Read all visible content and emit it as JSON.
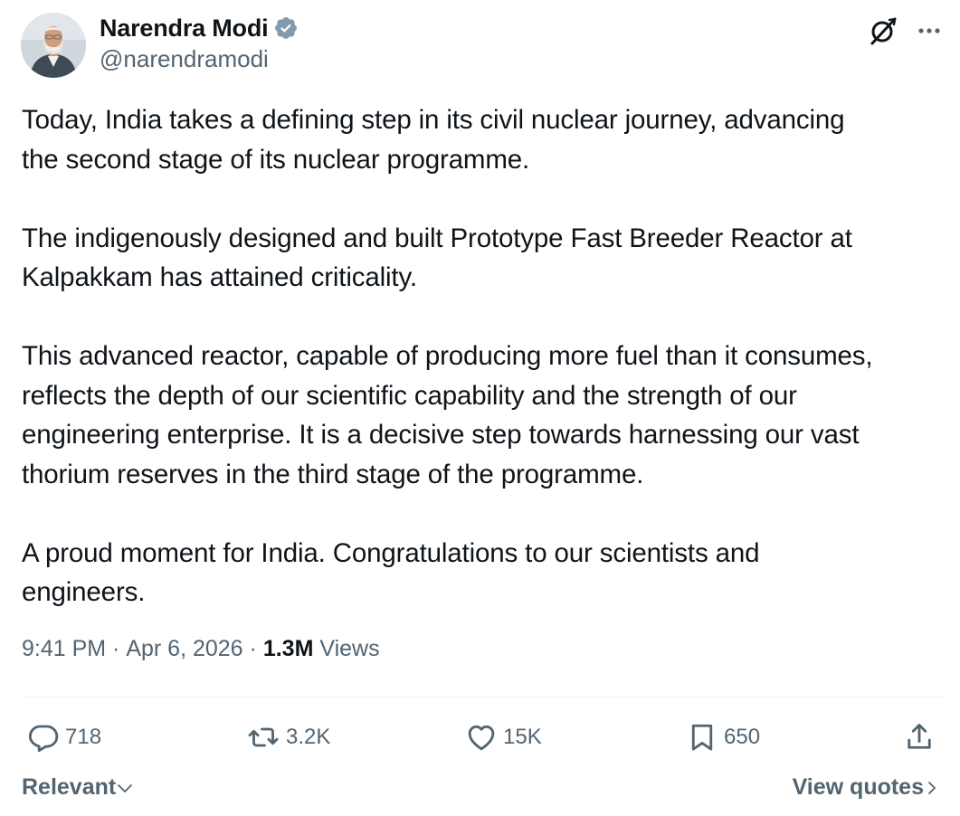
{
  "author": {
    "display_name": "Narendra Modi",
    "handle": "@narendramodi",
    "verified": true
  },
  "tweet": {
    "paragraphs": [
      "Today, India takes a defining step in its civil nuclear journey, advancing\nthe second stage of its nuclear programme.",
      "The indigenously designed and built Prototype Fast Breeder Reactor at\nKalpakkam has attained criticality.",
      "This advanced reactor, capable of producing more fuel than it consumes,\nreflects the depth of our scientific capability and the strength of our\nengineering enterprise. It is a decisive step towards harnessing our vast\nthorium reserves in the third stage of the programme.",
      "A proud moment for India. Congratulations to our scientists and\nengineers."
    ]
  },
  "meta": {
    "time": "9:41 PM",
    "date": "Apr 6, 2026",
    "views_count": "1.3M",
    "views_label": " Views"
  },
  "actions": {
    "replies": "718",
    "reposts": "3.2K",
    "likes": "15K",
    "bookmarks": "650"
  },
  "footer": {
    "sort_label": "Relevant",
    "quotes_label": "View quotes"
  },
  "icons": {
    "verified": "verified-badge-icon",
    "grok": "grok-icon",
    "more": "more-horizontal-icon",
    "reply": "reply-icon",
    "repost": "repost-icon",
    "like": "heart-icon",
    "bookmark": "bookmark-icon",
    "share": "share-icon"
  },
  "colors": {
    "text_primary": "#0f1419",
    "text_secondary": "#536471",
    "divider": "#eff3f4",
    "verified_badge": "#829aab"
  }
}
